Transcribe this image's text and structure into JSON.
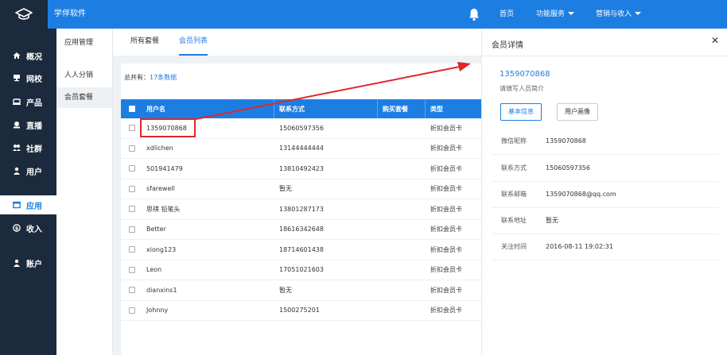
{
  "topbar": {
    "app_title": "学伴软件",
    "nav_home": "首页",
    "nav_service": "功能服务",
    "nav_marketing": "营销与收入",
    "accent": "#1d7ee2"
  },
  "sidebar": {
    "items": [
      {
        "label": "概况",
        "icon": "home-icon"
      },
      {
        "label": "网校",
        "icon": "school-icon"
      },
      {
        "label": "产品",
        "icon": "product-icon"
      },
      {
        "label": "直播",
        "icon": "live-icon"
      },
      {
        "label": "社群",
        "icon": "community-icon"
      },
      {
        "label": "用户",
        "icon": "user-icon"
      },
      {
        "label": "应用",
        "icon": "app-icon"
      },
      {
        "label": "收入",
        "icon": "income-icon"
      },
      {
        "label": "账户",
        "icon": "account-icon"
      }
    ],
    "active": "应用"
  },
  "subnav": {
    "title": "应用管理",
    "items": [
      "人人分销",
      "会员套餐"
    ],
    "active": "会员套餐"
  },
  "tabs": [
    "所有套餐",
    "会员列表"
  ],
  "active_tab": "会员列表",
  "summary": {
    "prefix": "总共有：",
    "count": "17条数据"
  },
  "table": {
    "headers": [
      "用户名",
      "联系方式",
      "购买套餐",
      "类型"
    ],
    "rows": [
      {
        "name": "1359070868",
        "contact": "15060597356",
        "package": "",
        "type": "折扣会员卡"
      },
      {
        "name": "xdlichen",
        "contact": "13144444444",
        "package": "",
        "type": "折扣会员卡"
      },
      {
        "name": "501941479",
        "contact": "13810492423",
        "package": "",
        "type": "折扣会员卡"
      },
      {
        "name": "sfarewell",
        "contact": "暂无",
        "package": "",
        "type": "折扣会员卡"
      },
      {
        "name": "思祺 铅笔头",
        "contact": "13801287173",
        "package": "",
        "type": "折扣会员卡"
      },
      {
        "name": "Better",
        "contact": "18616342648",
        "package": "",
        "type": "折扣会员卡"
      },
      {
        "name": "xiong123",
        "contact": "18714601438",
        "package": "",
        "type": "折扣会员卡"
      },
      {
        "name": "Leon",
        "contact": "17051021603",
        "package": "",
        "type": "折扣会员卡"
      },
      {
        "name": "dianxins1",
        "contact": "暂无",
        "package": "",
        "type": "折扣会员卡"
      },
      {
        "name": "Johnny",
        "contact": "1500275201",
        "package": "",
        "type": "折扣会员卡"
      }
    ]
  },
  "detail": {
    "title": "会员详情",
    "close": "✕",
    "name": "1359070868",
    "intro": "请填写人员简介",
    "btn_basic": "基本信息",
    "btn_avatar": "用户画像",
    "fields": [
      {
        "label": "微信昵称",
        "value": "1359070868"
      },
      {
        "label": "联系方式",
        "value": "15060597356"
      },
      {
        "label": "联系邮箱",
        "value": "1359070868@qq.com"
      },
      {
        "label": "联系地址",
        "value": "暂无"
      },
      {
        "label": "关注时间",
        "value": "2016-08-11 19:02:31"
      }
    ]
  }
}
